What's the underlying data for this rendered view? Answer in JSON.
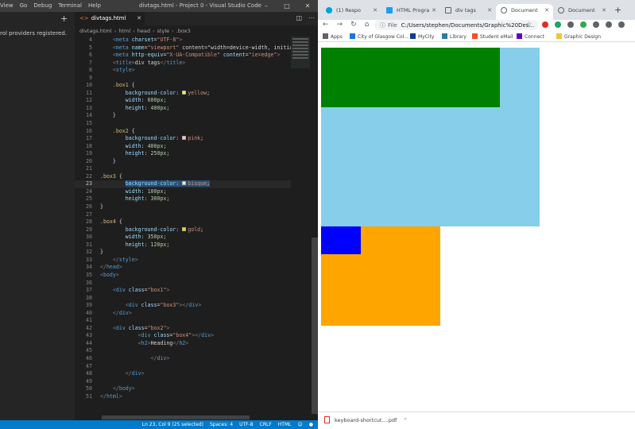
{
  "vscode": {
    "menu": [
      "View",
      "Go",
      "Debug",
      "Terminal",
      "Help"
    ],
    "window_title": "divtags.html - Project 0 - Visual Studio Code",
    "sidebar_message": "rol providers registered.",
    "tab": {
      "label": "divtags.html"
    },
    "breadcrumb": [
      "divtags.html",
      "html",
      "head",
      "style",
      ".box3"
    ],
    "code_lines": [
      {
        "n": 4,
        "text": "    <meta charset=\"UTF-8\">"
      },
      {
        "n": 5,
        "text": "    <meta name=\"viewport\" content=\"width=device-width, initia"
      },
      {
        "n": 6,
        "text": "    <meta http-equiv=\"X-UA-Compatible\" content=\"ie=edge\">"
      },
      {
        "n": 7,
        "text": "    <title>div tags</title>"
      },
      {
        "n": 8,
        "text": "    <style>"
      },
      {
        "n": 9,
        "text": ""
      },
      {
        "n": 10,
        "text": "    .box1 {"
      },
      {
        "n": 11,
        "text": "        background-color: yellow;"
      },
      {
        "n": 12,
        "text": "        width: 600px;"
      },
      {
        "n": 13,
        "text": "        height: 400px;"
      },
      {
        "n": 14,
        "text": "    }"
      },
      {
        "n": 15,
        "text": ""
      },
      {
        "n": 16,
        "text": "    .box2 {"
      },
      {
        "n": 17,
        "text": "        background-color: pink;"
      },
      {
        "n": 18,
        "text": "        width: 400px;"
      },
      {
        "n": 19,
        "text": "        height: 250px;"
      },
      {
        "n": 20,
        "text": "    }"
      },
      {
        "n": 21,
        "text": ""
      },
      {
        "n": 22,
        "text": ".box3 {"
      },
      {
        "n": 23,
        "text": "        background-color: bisque;"
      },
      {
        "n": 24,
        "text": "        width: 100px;"
      },
      {
        "n": 25,
        "text": "        height: 300px;"
      },
      {
        "n": 26,
        "text": "}"
      },
      {
        "n": 27,
        "text": ""
      },
      {
        "n": 28,
        "text": ".box4 {"
      },
      {
        "n": 29,
        "text": "        background-color: gold;"
      },
      {
        "n": 30,
        "text": "        width: 350px;"
      },
      {
        "n": 31,
        "text": "        height: 120px;"
      },
      {
        "n": 32,
        "text": "}"
      },
      {
        "n": 33,
        "text": "    </style>"
      },
      {
        "n": 34,
        "text": "</head>"
      },
      {
        "n": 35,
        "text": "<body>"
      },
      {
        "n": 36,
        "text": ""
      },
      {
        "n": 37,
        "text": "    <div class=\"box1\">"
      },
      {
        "n": 38,
        "text": ""
      },
      {
        "n": 39,
        "text": "        <div class=\"box3\"></div>"
      },
      {
        "n": 40,
        "text": "    </div>"
      },
      {
        "n": 41,
        "text": ""
      },
      {
        "n": 42,
        "text": "    <div class=\"box2\">"
      },
      {
        "n": 43,
        "text": "            <div class=\"box4\"></div>"
      },
      {
        "n": 44,
        "text": "            <h2>Heading</h2>"
      },
      {
        "n": 45,
        "text": ""
      },
      {
        "n": 46,
        "text": "                </div>"
      },
      {
        "n": 47,
        "text": ""
      },
      {
        "n": 48,
        "text": "        </div>"
      },
      {
        "n": 49,
        "text": ""
      },
      {
        "n": 50,
        "text": "    </body>"
      },
      {
        "n": 51,
        "text": "</html>"
      }
    ],
    "current_line": 23,
    "status": [
      "Ln 23, Col 9 (25 selected)",
      "Spaces: 4",
      "UTF-8",
      "CRLF",
      "HTML"
    ]
  },
  "chrome": {
    "tabs": [
      {
        "label": "(1) Respo",
        "icon_color": "#00a0dc"
      },
      {
        "label": "HTML Progra",
        "icon_color": "#1f9cf0"
      },
      {
        "label": "div tags",
        "icon_color": "#5f6368"
      },
      {
        "label": "Document",
        "icon_color": "#5f6368"
      },
      {
        "label": "Document",
        "icon_color": "#5f6368"
      }
    ],
    "active_tab": 3,
    "omnibox": {
      "scheme": "File",
      "url": "C:/Users/stephen/Documents/Graphic%20Des..."
    },
    "extension_colors": [
      "#e62b1e",
      "#1da462",
      "#5f6368",
      "#34a853",
      "#5f6368",
      "#5f6368",
      "#5f6368"
    ],
    "bookmarks": [
      {
        "label": "Apps",
        "color": "#5f6368"
      },
      {
        "label": "City of Glasgow Col...",
        "color": "#1a73e8"
      },
      {
        "label": "MyCity",
        "color": "#0b3d91"
      },
      {
        "label": "Library",
        "color": "#2a7ab0"
      },
      {
        "label": "Student eMail",
        "color": "#f25022"
      },
      {
        "label": "Connect",
        "color": "#6001d2"
      },
      {
        "label": "Graphic Design",
        "color": "#f4c430"
      }
    ],
    "render_colors": {
      "box1": "#87ceeb",
      "box3": "#008000",
      "box2": "#ffa500",
      "box4": "#0000ff"
    },
    "download": {
      "filename": "keyboard-shortcut....pdf"
    }
  }
}
